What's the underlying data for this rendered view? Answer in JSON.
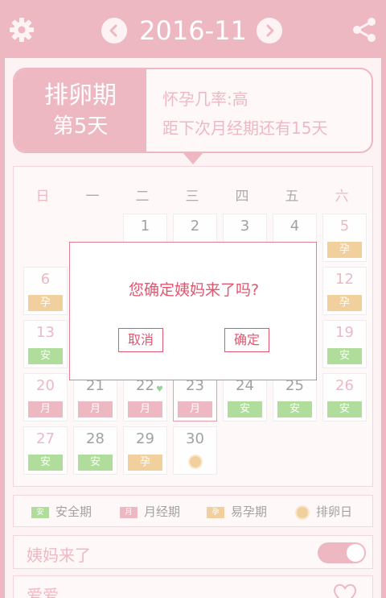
{
  "header": {
    "month": "2016-11",
    "icons": {
      "settings": "gear-icon",
      "prev": "chevron-left-icon",
      "next": "chevron-right-icon",
      "share": "share-icon"
    }
  },
  "status": {
    "phase": "排卵期",
    "day": "第5天",
    "chance_line": "怀孕几率:高",
    "next_period_line": "距下次月经期还有15天"
  },
  "calendar": {
    "weekdays": [
      "日",
      "一",
      "二",
      "三",
      "四",
      "五",
      "六"
    ],
    "days": [
      {
        "n": "1",
        "col": 2,
        "row": 0,
        "tag": "",
        "tagtype": ""
      },
      {
        "n": "2",
        "col": 3,
        "row": 0,
        "tag": "",
        "tagtype": ""
      },
      {
        "n": "3",
        "col": 4,
        "row": 0,
        "tag": "",
        "tagtype": ""
      },
      {
        "n": "4",
        "col": 5,
        "row": 0,
        "tag": "",
        "tagtype": ""
      },
      {
        "n": "5",
        "col": 6,
        "row": 0,
        "tag": "孕",
        "tagtype": "fertile"
      },
      {
        "n": "6",
        "col": 0,
        "row": 1,
        "tag": "孕",
        "tagtype": "fertile"
      },
      {
        "n": "12",
        "col": 6,
        "row": 1,
        "tag": "孕",
        "tagtype": "fertile"
      },
      {
        "n": "13",
        "col": 0,
        "row": 2,
        "tag": "安",
        "tagtype": "safe"
      },
      {
        "n": "19",
        "col": 6,
        "row": 2,
        "tag": "安",
        "tagtype": "safe"
      },
      {
        "n": "20",
        "col": 0,
        "row": 3,
        "tag": "月",
        "tagtype": "period"
      },
      {
        "n": "21",
        "col": 1,
        "row": 3,
        "tag": "月",
        "tagtype": "period"
      },
      {
        "n": "22",
        "col": 2,
        "row": 3,
        "tag": "月",
        "tagtype": "period"
      },
      {
        "n": "23",
        "col": 3,
        "row": 3,
        "tag": "月",
        "tagtype": "period"
      },
      {
        "n": "24",
        "col": 4,
        "row": 3,
        "tag": "安",
        "tagtype": "safe"
      },
      {
        "n": "25",
        "col": 5,
        "row": 3,
        "tag": "安",
        "tagtype": "safe"
      },
      {
        "n": "26",
        "col": 6,
        "row": 3,
        "tag": "安",
        "tagtype": "safe"
      },
      {
        "n": "27",
        "col": 0,
        "row": 4,
        "tag": "安",
        "tagtype": "safe"
      },
      {
        "n": "28",
        "col": 1,
        "row": 4,
        "tag": "安",
        "tagtype": "safe"
      },
      {
        "n": "29",
        "col": 2,
        "row": 4,
        "tag": "孕",
        "tagtype": "fertile"
      },
      {
        "n": "30",
        "col": 3,
        "row": 4,
        "tag": "",
        "tagtype": "egg"
      }
    ]
  },
  "legend": {
    "safe": {
      "label": "安全期",
      "mark": "安"
    },
    "period": {
      "label": "月经期",
      "mark": "月"
    },
    "fertile": {
      "label": "易孕期",
      "mark": "孕"
    },
    "ovulation": {
      "label": "排卵日"
    }
  },
  "rows": {
    "period_came": "姨妈来了",
    "love": "爱爱"
  },
  "dialog": {
    "message": "您确定姨妈来了吗?",
    "cancel": "取消",
    "confirm": "确定"
  },
  "colors": {
    "accent": "#e07f92",
    "safe": "#6fc24b",
    "fertile": "#e7a94f"
  }
}
